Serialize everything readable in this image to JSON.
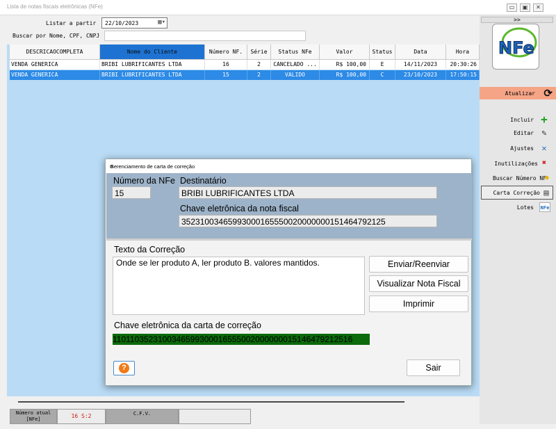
{
  "window": {
    "title": "Lista de notas fiscais eletrônicas (NFe)",
    "minimize": "▭",
    "maximize": "▣",
    "close": "✕"
  },
  "filters": {
    "listar_label": "Listar a partir",
    "listar_value": "22/10/2023",
    "buscar_label": "Buscar por Nome, CPF, CNPJ",
    "buscar_value": ""
  },
  "grid": {
    "columns": [
      "DESCRICAOCOMPLETA",
      "Nome do Cliente",
      "Número NF.",
      "Série",
      "Status NFe",
      "Valor",
      "Status",
      "Data",
      "Hora"
    ],
    "rows": [
      [
        "VENDA GENERICA",
        "BRIBI LUBRIFICANTES LTDA",
        "16",
        "2",
        "CANCELADO ...",
        "R$ 100,00",
        "E",
        "14/11/2023",
        "20:30:26"
      ],
      [
        "VENDA GENERICA",
        "BRIBI LUBRIFICANTES LTDA",
        "15",
        "2",
        "VALIDO",
        "R$ 100,00",
        "C",
        "23/10/2023",
        "17:50:15"
      ]
    ]
  },
  "sidebar": {
    "expand": ">>",
    "logo_text": "NFe",
    "atualizar": "Atualizar",
    "items": [
      {
        "label": "Incluir",
        "icon": "plus-icon",
        "glyph": "+",
        "color": "#1aa01a"
      },
      {
        "label": "Editar",
        "icon": "pencil-icon",
        "glyph": "✎",
        "color": "#333333"
      },
      {
        "label": "Ajustes",
        "icon": "tools-icon",
        "glyph": "✕",
        "color": "#2a6fb8"
      },
      {
        "label": "Inutilizações",
        "icon": "x-mark-icon",
        "glyph": "✖",
        "color": "#d01818"
      },
      {
        "label": "Buscar Número NF",
        "icon": "bulb-icon",
        "glyph": "●",
        "color": "#e8b800"
      },
      {
        "label": "Carta Correção",
        "icon": "document-icon",
        "glyph": "▤",
        "color": "#555555"
      },
      {
        "label": "Lotes",
        "icon": "nfe-mini-icon",
        "glyph": "NFe",
        "color": "#1a6ab8"
      }
    ]
  },
  "statusbar": {
    "numero_atual_label": "Número atual\n[NFe]",
    "numero_atual_value": "16 S:2",
    "cfv": "C.F.V.",
    "empty": ""
  },
  "dialog": {
    "title": "Gerenciamento de carta de correção",
    "close": "✕",
    "numero_label": "Número da NFe",
    "numero_value": "15",
    "destinatario_label": "Destinatário",
    "destinatario_value": "BRIBI LUBRIFICANTES LTDA",
    "chave_nf_label": "Chave eletrônica da nota fiscal",
    "chave_nf_value": "35231003465993000165550020000000151464792125",
    "texto_label": "Texto da Correção",
    "texto_value": "Onde se ler produto A, ler produto B. valores mantidos.",
    "btn_enviar": "Enviar/Reenviar",
    "btn_visualizar": "Visualizar Nota Fiscal",
    "btn_imprimir": "Imprimir",
    "chave_cc_label": "Chave eletrônica da carta de correção",
    "chave_cc_value": "110110352310034659930001655500200000001514647921251​6",
    "help": "?",
    "btn_sair": "Sair"
  },
  "colors": {
    "grid_bg": "#b9dbf5",
    "selected_row": "#2d8ae6",
    "atualizar_bg": "#f5a586",
    "dialog_header_bg": "#9db3c9",
    "chave_cc_bg": "#0b6a0b"
  }
}
